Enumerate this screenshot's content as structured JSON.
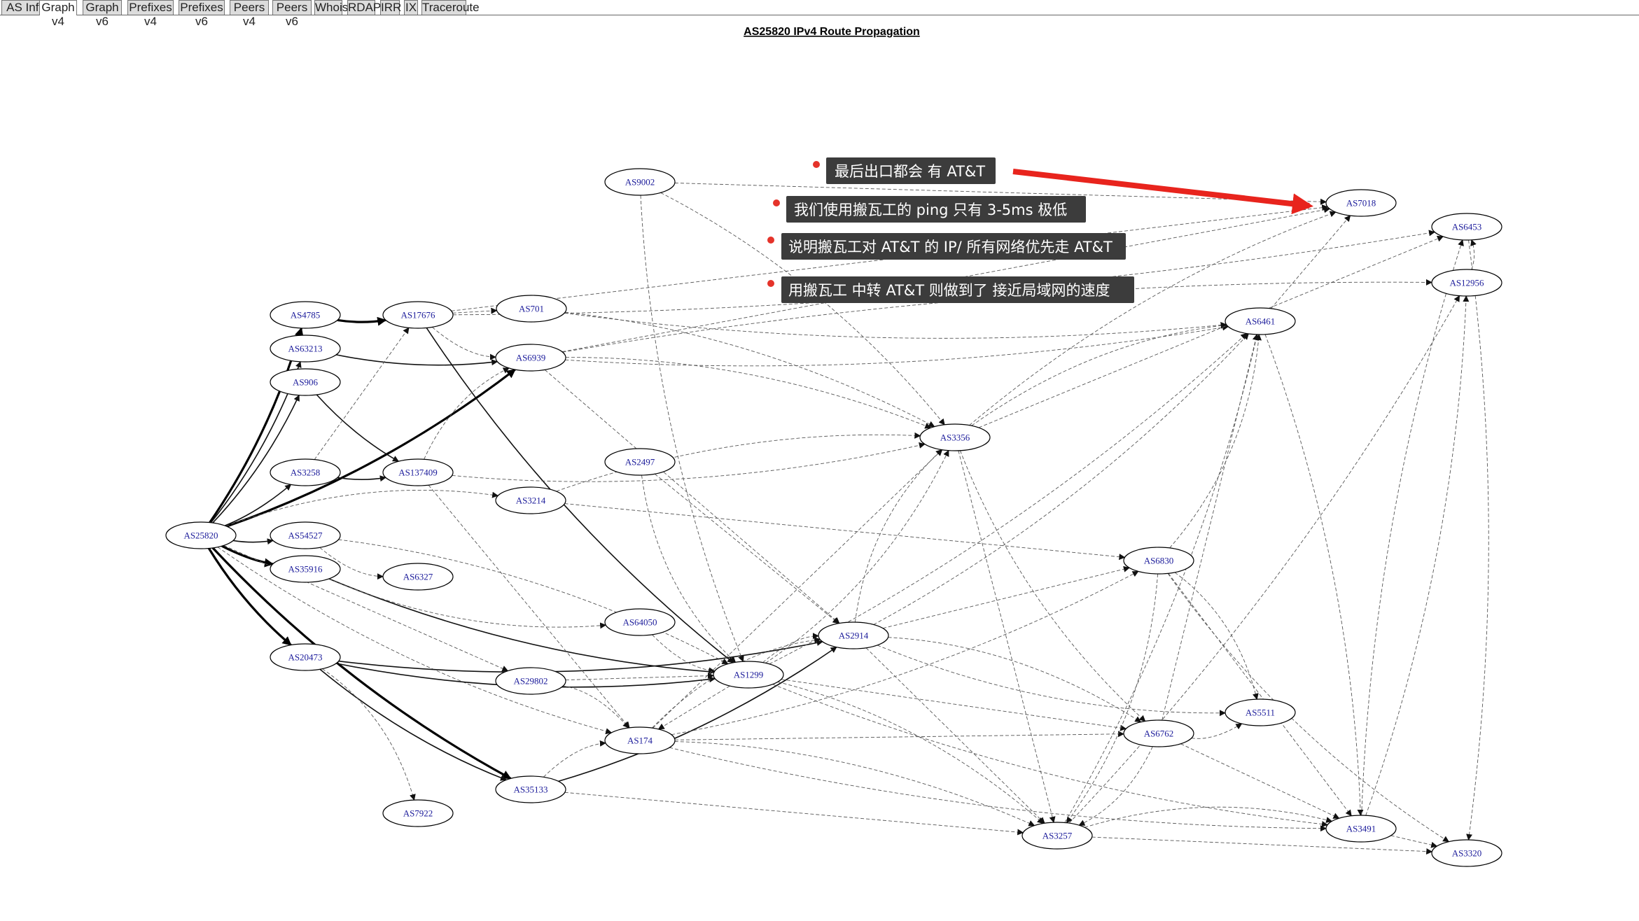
{
  "tabs": [
    {
      "label": "AS Info"
    },
    {
      "label": "Graph v4",
      "active": true
    },
    {
      "label": "Graph v6"
    },
    {
      "label": "Prefixes v4"
    },
    {
      "label": "Prefixes v6"
    },
    {
      "label": "Peers v4"
    },
    {
      "label": "Peers v6"
    },
    {
      "label": "Whois"
    },
    {
      "label": "RDAP"
    },
    {
      "label": "IRR"
    },
    {
      "label": "IX"
    },
    {
      "label": "Traceroute"
    }
  ],
  "graph": {
    "title": "AS25820 IPv4 Route Propagation",
    "nodes": [
      {
        "id": "AS25820"
      },
      {
        "id": "AS4785"
      },
      {
        "id": "AS63213"
      },
      {
        "id": "AS906"
      },
      {
        "id": "AS3258"
      },
      {
        "id": "AS54527"
      },
      {
        "id": "AS35916"
      },
      {
        "id": "AS20473"
      },
      {
        "id": "AS17676"
      },
      {
        "id": "AS6327"
      },
      {
        "id": "AS137409"
      },
      {
        "id": "AS7922"
      },
      {
        "id": "AS9002"
      },
      {
        "id": "AS701"
      },
      {
        "id": "AS6939"
      },
      {
        "id": "AS2497"
      },
      {
        "id": "AS3214"
      },
      {
        "id": "AS64050"
      },
      {
        "id": "AS29802"
      },
      {
        "id": "AS35133"
      },
      {
        "id": "AS1299"
      },
      {
        "id": "AS174"
      },
      {
        "id": "AS2914"
      },
      {
        "id": "AS3356"
      },
      {
        "id": "AS6830"
      },
      {
        "id": "AS6762"
      },
      {
        "id": "AS3257"
      },
      {
        "id": "AS6461"
      },
      {
        "id": "AS5511"
      },
      {
        "id": "AS7018"
      },
      {
        "id": "AS3491"
      },
      {
        "id": "AS6453"
      },
      {
        "id": "AS12956"
      },
      {
        "id": "AS3320"
      }
    ],
    "edges": [
      {
        "from": "AS25820",
        "to": "AS4785",
        "weight": "bold"
      },
      {
        "from": "AS25820",
        "to": "AS63213",
        "weight": "normal"
      },
      {
        "from": "AS25820",
        "to": "AS906",
        "weight": "normal"
      },
      {
        "from": "AS25820",
        "to": "AS3258",
        "weight": "normal"
      },
      {
        "from": "AS25820",
        "to": "AS54527",
        "weight": "normal"
      },
      {
        "from": "AS25820",
        "to": "AS35916",
        "weight": "bold"
      },
      {
        "from": "AS25820",
        "to": "AS20473",
        "weight": "bold"
      },
      {
        "from": "AS25820",
        "to": "AS6939",
        "weight": "bold"
      },
      {
        "from": "AS25820",
        "to": "AS35133",
        "weight": "bold"
      },
      {
        "from": "AS25820",
        "to": "AS3214",
        "weight": "thin"
      },
      {
        "from": "AS25820",
        "to": "AS29802",
        "weight": "thin"
      },
      {
        "from": "AS25820",
        "to": "AS174",
        "weight": "thin"
      },
      {
        "from": "AS4785",
        "to": "AS17676",
        "weight": "bold"
      },
      {
        "from": "AS63213",
        "to": "AS6939",
        "weight": "normal"
      },
      {
        "from": "AS906",
        "to": "AS137409",
        "weight": "normal"
      },
      {
        "from": "AS3258",
        "to": "AS137409",
        "weight": "normal"
      },
      {
        "from": "AS3258",
        "to": "AS17676",
        "weight": "thin"
      },
      {
        "from": "AS54527",
        "to": "AS6327",
        "weight": "thin"
      },
      {
        "from": "AS54527",
        "to": "AS1299",
        "weight": "thin"
      },
      {
        "from": "AS35916",
        "to": "AS1299",
        "weight": "normal"
      },
      {
        "from": "AS35916",
        "to": "AS64050",
        "weight": "thin"
      },
      {
        "from": "AS20473",
        "to": "AS2914",
        "weight": "normal"
      },
      {
        "from": "AS20473",
        "to": "AS1299",
        "weight": "normal"
      },
      {
        "from": "AS20473",
        "to": "AS35133",
        "weight": "normal"
      },
      {
        "from": "AS20473",
        "to": "AS7922",
        "weight": "thin"
      },
      {
        "from": "AS17676",
        "to": "AS701",
        "weight": "thin"
      },
      {
        "from": "AS17676",
        "to": "AS6939",
        "weight": "thin"
      },
      {
        "from": "AS17676",
        "to": "AS1299",
        "weight": "normal"
      },
      {
        "from": "AS17676",
        "to": "AS7018",
        "weight": "thin"
      },
      {
        "from": "AS17676",
        "to": "AS6453",
        "weight": "thin"
      },
      {
        "from": "AS137409",
        "to": "AS6939",
        "weight": "thin"
      },
      {
        "from": "AS137409",
        "to": "AS174",
        "weight": "thin"
      },
      {
        "from": "AS137409",
        "to": "AS3356",
        "weight": "thin"
      },
      {
        "from": "AS6939",
        "to": "AS3356",
        "weight": "thin"
      },
      {
        "from": "AS6939",
        "to": "AS2914",
        "weight": "thin"
      },
      {
        "from": "AS6939",
        "to": "AS6461",
        "weight": "thin"
      },
      {
        "from": "AS6939",
        "to": "AS12956",
        "weight": "thin"
      },
      {
        "from": "AS6939",
        "to": "AS7018",
        "weight": "thin"
      },
      {
        "from": "AS701",
        "to": "AS6461",
        "weight": "thin"
      },
      {
        "from": "AS701",
        "to": "AS3356",
        "weight": "thin"
      },
      {
        "from": "AS9002",
        "to": "AS7018",
        "weight": "thin"
      },
      {
        "from": "AS9002",
        "to": "AS1299",
        "weight": "thin"
      },
      {
        "from": "AS9002",
        "to": "AS3356",
        "weight": "thin"
      },
      {
        "from": "AS2497",
        "to": "AS2914",
        "weight": "thin"
      },
      {
        "from": "AS2497",
        "to": "AS1299",
        "weight": "thin"
      },
      {
        "from": "AS3214",
        "to": "AS3356",
        "weight": "thin"
      },
      {
        "from": "AS3214",
        "to": "AS6830",
        "weight": "thin"
      },
      {
        "from": "AS64050",
        "to": "AS1299",
        "weight": "thin"
      },
      {
        "from": "AS29802",
        "to": "AS174",
        "weight": "thin"
      },
      {
        "from": "AS29802",
        "to": "AS1299",
        "weight": "thin"
      },
      {
        "from": "AS35133",
        "to": "AS2914",
        "weight": "normal"
      },
      {
        "from": "AS35133",
        "to": "AS174",
        "weight": "thin"
      },
      {
        "from": "AS35133",
        "to": "AS3257",
        "weight": "thin"
      },
      {
        "from": "AS1299",
        "to": "AS3356",
        "weight": "thin"
      },
      {
        "from": "AS1299",
        "to": "AS2914",
        "weight": "thin"
      },
      {
        "from": "AS1299",
        "to": "AS174",
        "weight": "thin"
      },
      {
        "from": "AS1299",
        "to": "AS6461",
        "weight": "thin"
      },
      {
        "from": "AS1299",
        "to": "AS3257",
        "weight": "thin"
      },
      {
        "from": "AS1299",
        "to": "AS6762",
        "weight": "thin"
      },
      {
        "from": "AS1299",
        "to": "AS3491",
        "weight": "thin"
      },
      {
        "from": "AS174",
        "to": "AS2914",
        "weight": "thin"
      },
      {
        "from": "AS174",
        "to": "AS3356",
        "weight": "thin"
      },
      {
        "from": "AS174",
        "to": "AS6830",
        "weight": "thin"
      },
      {
        "from": "AS174",
        "to": "AS3257",
        "weight": "thin"
      },
      {
        "from": "AS174",
        "to": "AS6762",
        "weight": "thin"
      },
      {
        "from": "AS174",
        "to": "AS3491",
        "weight": "thin"
      },
      {
        "from": "AS2914",
        "to": "AS3356",
        "weight": "thin"
      },
      {
        "from": "AS2914",
        "to": "AS6830",
        "weight": "thin"
      },
      {
        "from": "AS2914",
        "to": "AS6461",
        "weight": "thin"
      },
      {
        "from": "AS2914",
        "to": "AS6762",
        "weight": "thin"
      },
      {
        "from": "AS2914",
        "to": "AS3257",
        "weight": "thin"
      },
      {
        "from": "AS2914",
        "to": "AS5511",
        "weight": "thin"
      },
      {
        "from": "AS3356",
        "to": "AS6461",
        "weight": "thin"
      },
      {
        "from": "AS3356",
        "to": "AS3257",
        "weight": "thin"
      },
      {
        "from": "AS3356",
        "to": "AS6762",
        "weight": "thin"
      },
      {
        "from": "AS3356",
        "to": "AS7018",
        "weight": "thin"
      },
      {
        "from": "AS3356",
        "to": "AS6453",
        "weight": "thin"
      },
      {
        "from": "AS6830",
        "to": "AS6461",
        "weight": "thin"
      },
      {
        "from": "AS6830",
        "to": "AS5511",
        "weight": "thin"
      },
      {
        "from": "AS6830",
        "to": "AS3491",
        "weight": "thin"
      },
      {
        "from": "AS6830",
        "to": "AS3320",
        "weight": "thin"
      },
      {
        "from": "AS6830",
        "to": "AS3257",
        "weight": "thin"
      },
      {
        "from": "AS6762",
        "to": "AS6461",
        "weight": "thin"
      },
      {
        "from": "AS6762",
        "to": "AS5511",
        "weight": "thin"
      },
      {
        "from": "AS6762",
        "to": "AS3257",
        "weight": "thin"
      },
      {
        "from": "AS6762",
        "to": "AS3491",
        "weight": "thin"
      },
      {
        "from": "AS3257",
        "to": "AS6461",
        "weight": "thin"
      },
      {
        "from": "AS3257",
        "to": "AS3491",
        "weight": "thin"
      },
      {
        "from": "AS3257",
        "to": "AS3320",
        "weight": "thin"
      },
      {
        "from": "AS3257",
        "to": "AS12956",
        "weight": "thin"
      },
      {
        "from": "AS6461",
        "to": "AS3491",
        "weight": "thin"
      },
      {
        "from": "AS6461",
        "to": "AS7018",
        "weight": "thin"
      },
      {
        "from": "AS3491",
        "to": "AS12956",
        "weight": "thin"
      },
      {
        "from": "AS3491",
        "to": "AS6453",
        "weight": "thin"
      },
      {
        "from": "AS3491",
        "to": "AS3320",
        "weight": "thin"
      },
      {
        "from": "AS12956",
        "to": "AS6453",
        "weight": "thin"
      },
      {
        "from": "AS6453",
        "to": "AS3320",
        "weight": "thin"
      }
    ]
  },
  "annotations": [
    {
      "text": "最后出口都会 有 AT&T"
    },
    {
      "text": "我们使用搬瓦工的 ping 只有 3-5ms 极低"
    },
    {
      "text": "说明搬瓦工对 AT&T 的 IP/ 所有网络优先走 AT&T"
    },
    {
      "text": "用搬瓦工 中转 AT&T 则做到了 接近局域网的速度"
    }
  ],
  "colors": {
    "node_label": "#1a1a9a",
    "annotation_bg": "#3c3c3c",
    "annotation_dot": "#e5332a",
    "pointer_arrow": "#e8241d",
    "edge": "#555555"
  }
}
